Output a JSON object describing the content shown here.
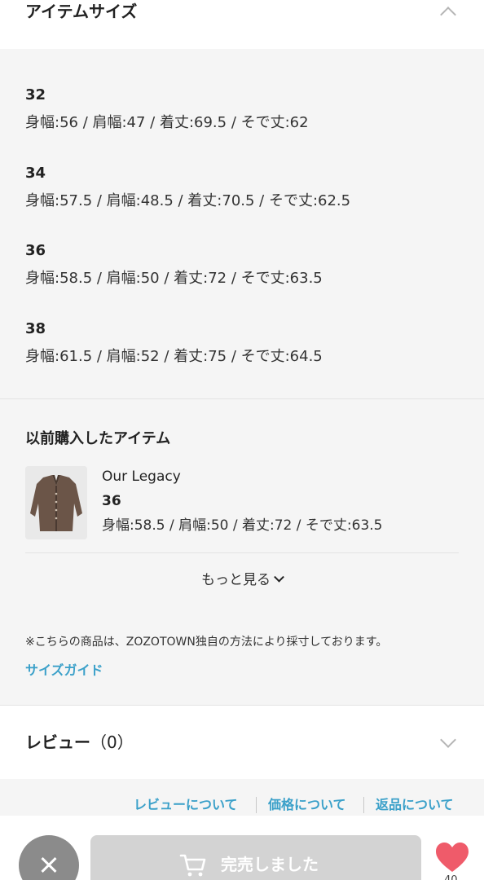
{
  "item_size_section": {
    "title": "アイテムサイズ",
    "sizes": [
      {
        "label": "32",
        "measurements": "身幅:56 / 肩幅:47 / 着丈:69.5 / そで丈:62"
      },
      {
        "label": "34",
        "measurements": "身幅:57.5 / 肩幅:48.5 / 着丈:70.5 / そで丈:62.5"
      },
      {
        "label": "36",
        "measurements": "身幅:58.5 / 肩幅:50 / 着丈:72 / そで丈:63.5"
      },
      {
        "label": "38",
        "measurements": "身幅:61.5 / 肩幅:52 / 着丈:75 / そで丈:64.5"
      }
    ]
  },
  "previous_purchase": {
    "title": "以前購入したアイテム",
    "item": {
      "brand": "Our Legacy",
      "size": "36",
      "measurements": "身幅:58.5 / 肩幅:50 / 着丈:72 / そで丈:63.5"
    },
    "more_label": "もっと見る"
  },
  "note": "※こちらの商品は、ZOZOTOWN独自の方法により採寸しております。",
  "size_guide_label": "サイズガイド",
  "review_section": {
    "title": "レビュー",
    "count": "（0）"
  },
  "footer_links": {
    "about_reviews": "レビューについて",
    "about_price": "価格について",
    "about_returns": "返品について"
  },
  "action_bar": {
    "soldout_label": "完売しました",
    "favorite_count": "40"
  },
  "colors": {
    "accent_link": "#3aa0c9",
    "favorite_heart": "#ef5b6a",
    "soldout_button": "#d3d3d3"
  }
}
